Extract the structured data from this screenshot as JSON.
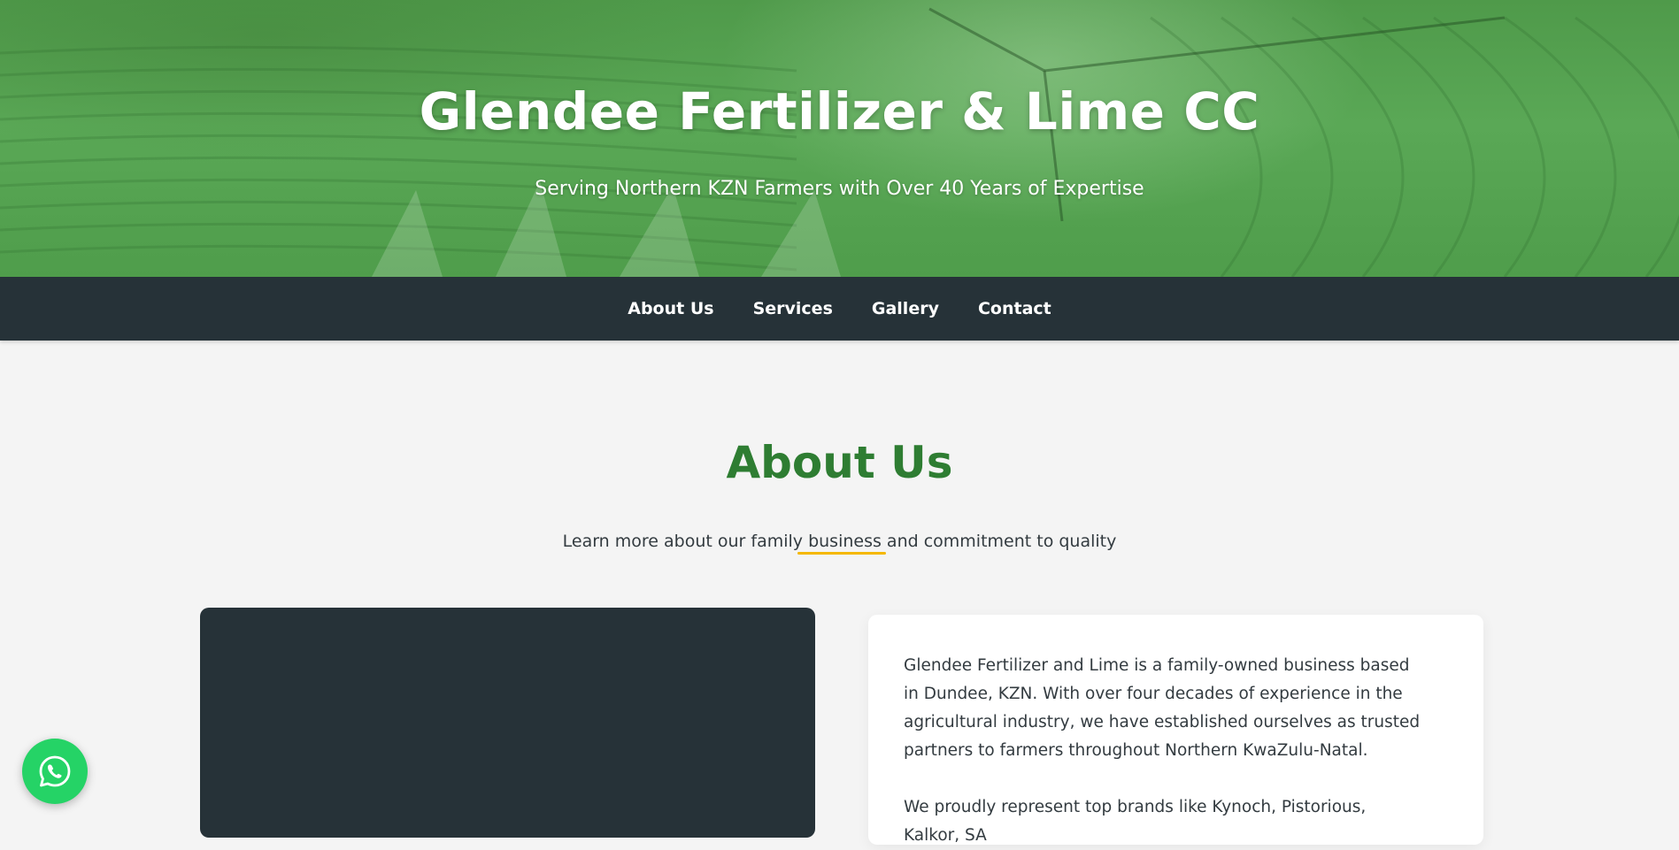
{
  "hero": {
    "title": "Glendee Fertilizer & Lime CC",
    "subtitle": "Serving Northern KZN Farmers with Over 40 Years of Expertise"
  },
  "nav": {
    "items": [
      {
        "label": "About Us"
      },
      {
        "label": "Services"
      },
      {
        "label": "Gallery"
      },
      {
        "label": "Contact"
      }
    ]
  },
  "about": {
    "title": "About Us",
    "subtitle": "Learn more about our family business and commitment to quality",
    "paragraphs": [
      "Glendee Fertilizer and Lime is a family-owned business based in Dundee, KZN. With over four decades of experience in the agricultural industry, we have established ourselves as trusted partners to farmers throughout Northern KwaZulu-Natal.",
      "We proudly represent top brands like Kynoch, Pistorious, Kalkor, SA"
    ]
  },
  "floating": {
    "whatsapp_icon": "whatsapp-icon"
  },
  "colors": {
    "nav_bg": "#263238",
    "heading_green": "#2e7d32",
    "accent_yellow": "#f5b700",
    "whatsapp_green": "#25d366"
  }
}
